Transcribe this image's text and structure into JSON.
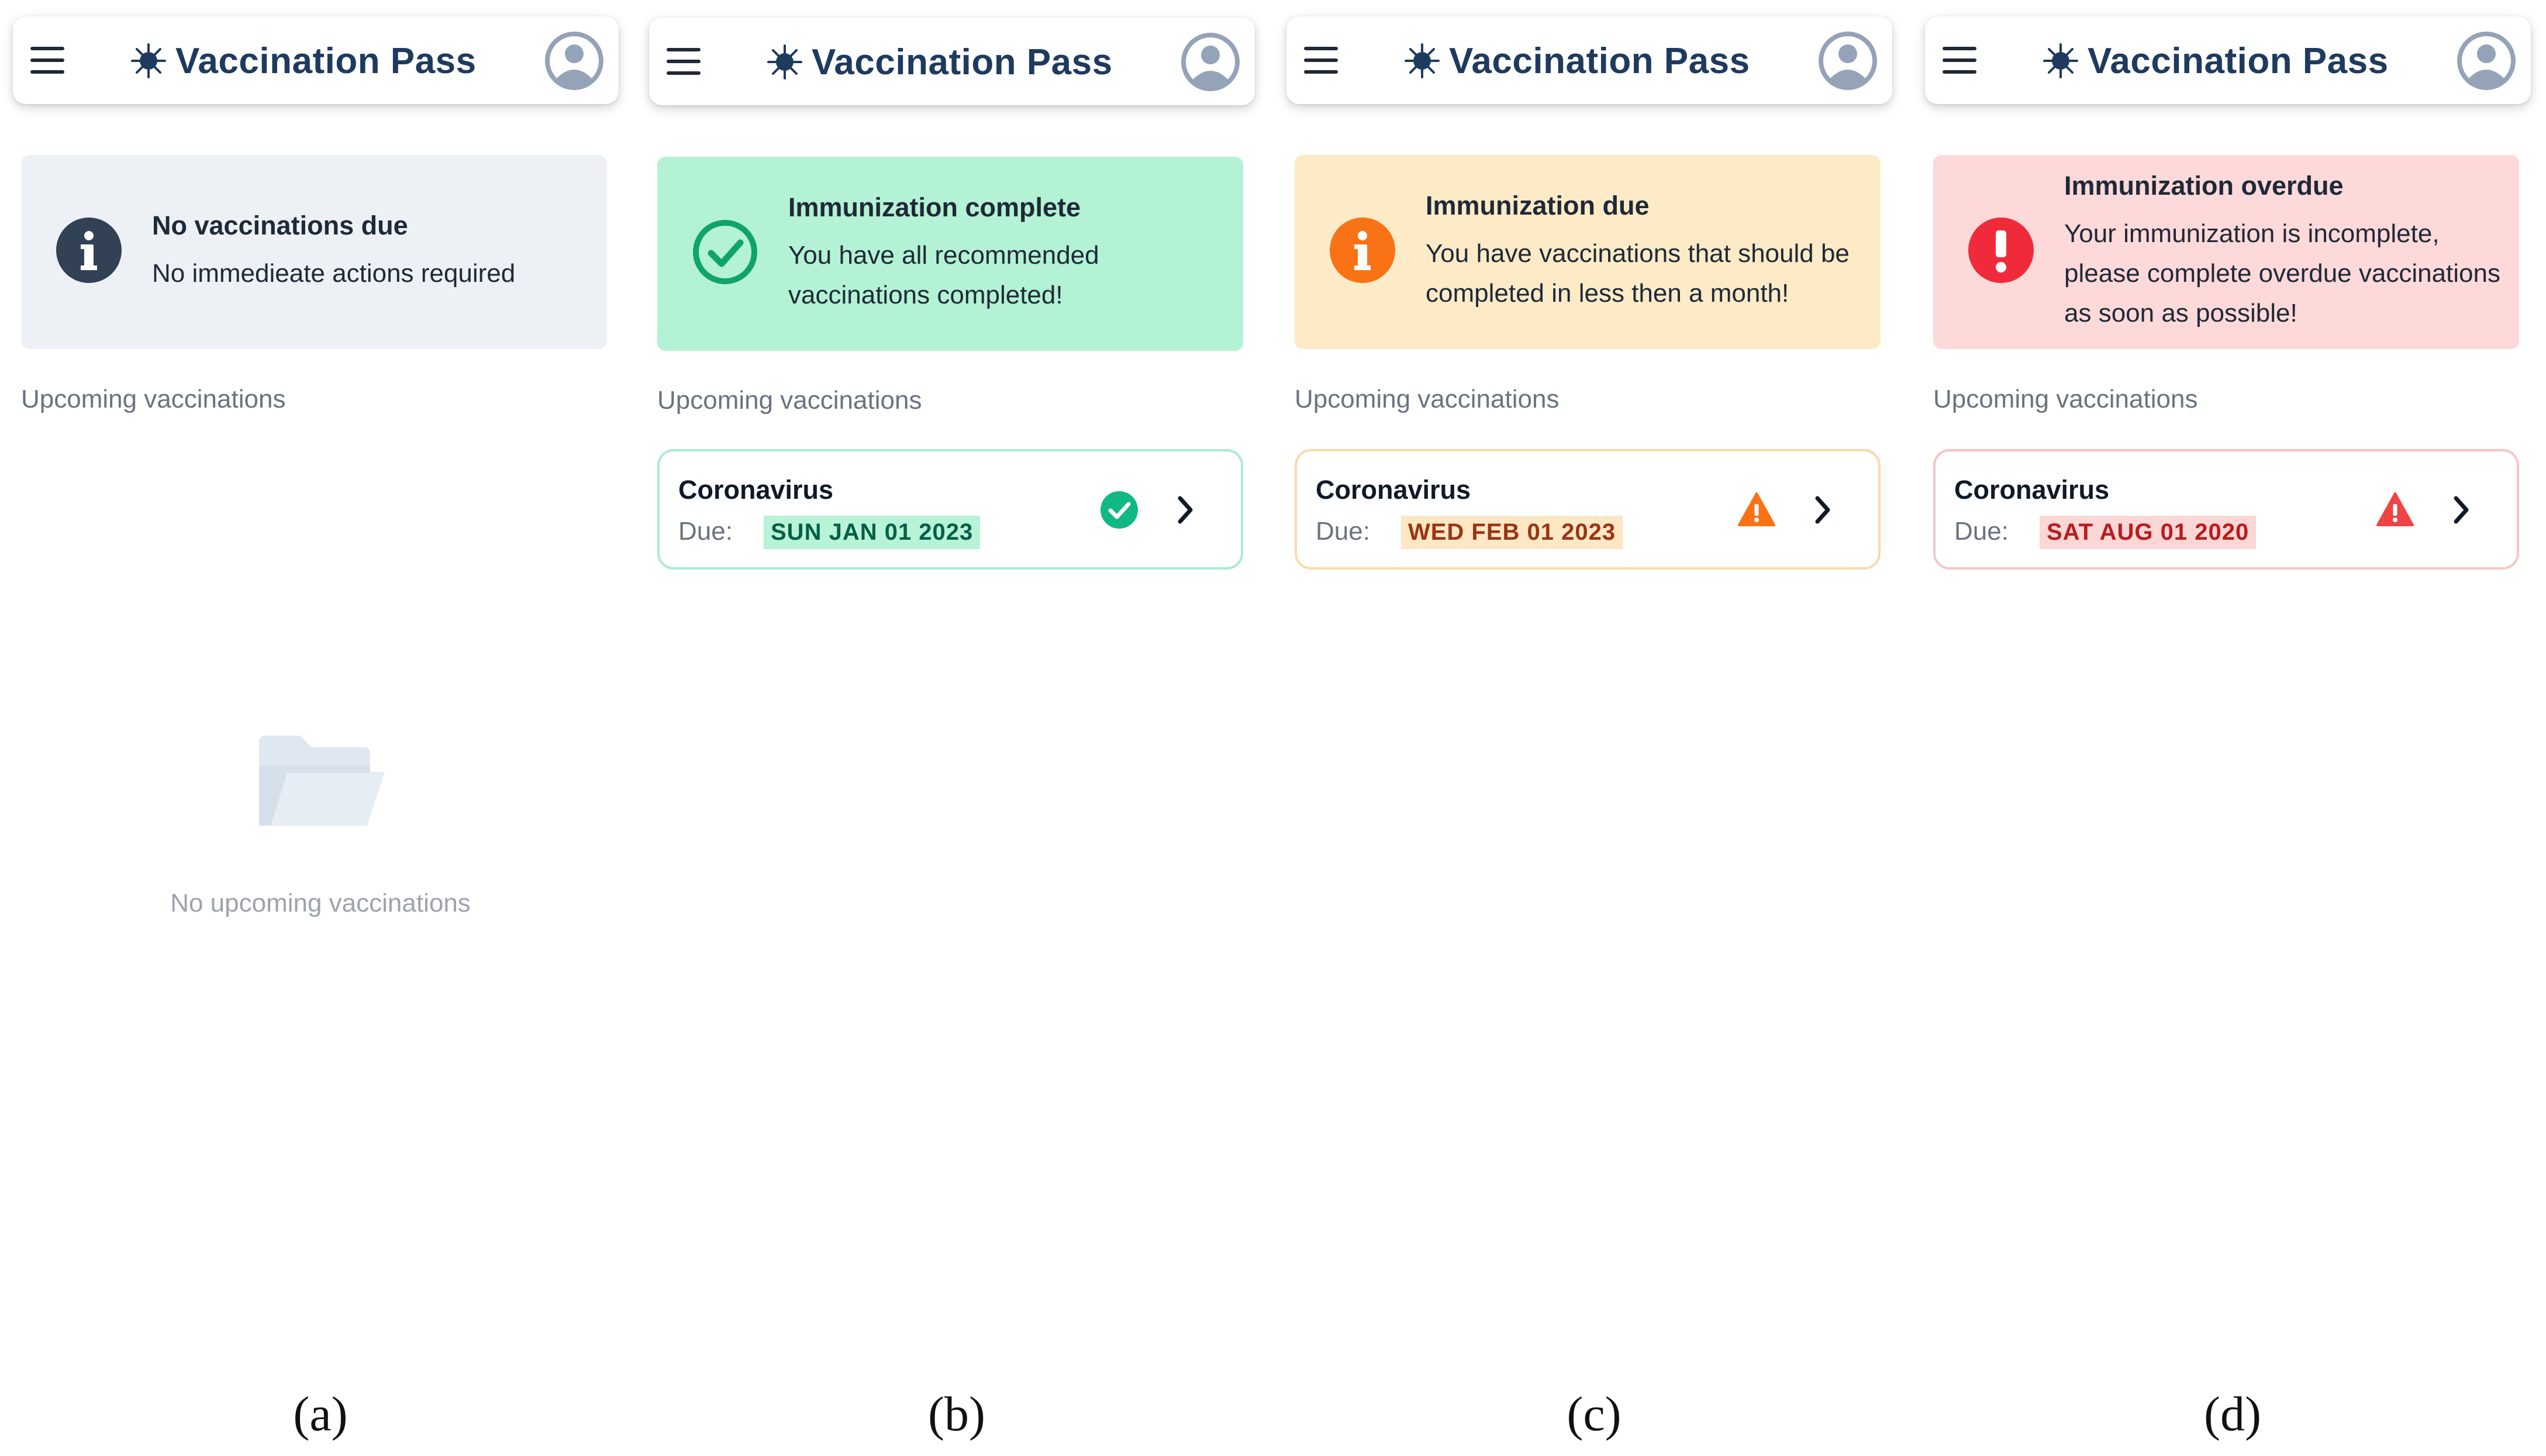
{
  "app": {
    "title": "Vaccination Pass"
  },
  "icons": {
    "menu": "hamburger-menu-icon",
    "brand": "virus-icon",
    "profile": "user-avatar-icon",
    "chevron": "chevron-right-icon",
    "empty": "folder-icon"
  },
  "common": {
    "upcoming_label": "Upcoming vaccinations",
    "due_label": "Due:"
  },
  "panels": [
    {
      "caption": "(a)",
      "alert": {
        "title": "No vaccinations due",
        "body": "No immedieate actions required",
        "icon": "info-icon",
        "background": "#edf1f6",
        "icon_color": "#334155"
      },
      "empty_state": {
        "text": "No upcoming vaccinations"
      }
    },
    {
      "caption": "(b)",
      "alert": {
        "title": "Immunization complete",
        "body": "You have all recommended vaccinations completed!",
        "icon": "check-circle-icon",
        "background": "#b3f2d4",
        "icon_color": "#10a36b"
      },
      "vaccination": {
        "name": "Coronavirus",
        "due_date": "SUN JAN 01 2023",
        "status_icon": "check-circle-icon",
        "accent": "#10b981",
        "badge_bg": "#b7f3d6",
        "badge_text": "#065f46",
        "border": "#a7ecd0"
      }
    },
    {
      "caption": "(c)",
      "alert": {
        "title": "Immunization due",
        "body": "You have vaccinations that should be completed in less then a month!",
        "icon": "info-icon",
        "background": "#fdebc8",
        "icon_color": "#f97316"
      },
      "vaccination": {
        "name": "Coronavirus",
        "due_date": "WED FEB 01 2023",
        "status_icon": "warning-icon",
        "accent": "#f97316",
        "badge_bg": "#fde7c4",
        "badge_text": "#9a3412",
        "border": "#fbd9a8"
      }
    },
    {
      "caption": "(d)",
      "alert": {
        "title": "Immunization overdue",
        "body": "Your immunization is incomplete, please complete overdue vaccinations as soon as possible!",
        "icon": "exclamation-circle-icon",
        "background": "#fdd9d9",
        "icon_color": "#ef2b3b"
      },
      "vaccination": {
        "name": "Coronavirus",
        "due_date": "SAT AUG 01 2020",
        "status_icon": "warning-icon",
        "accent": "#ef4444",
        "badge_bg": "#fdd6d6",
        "badge_text": "#b91c1c",
        "border": "#f9c4c4"
      }
    }
  ]
}
